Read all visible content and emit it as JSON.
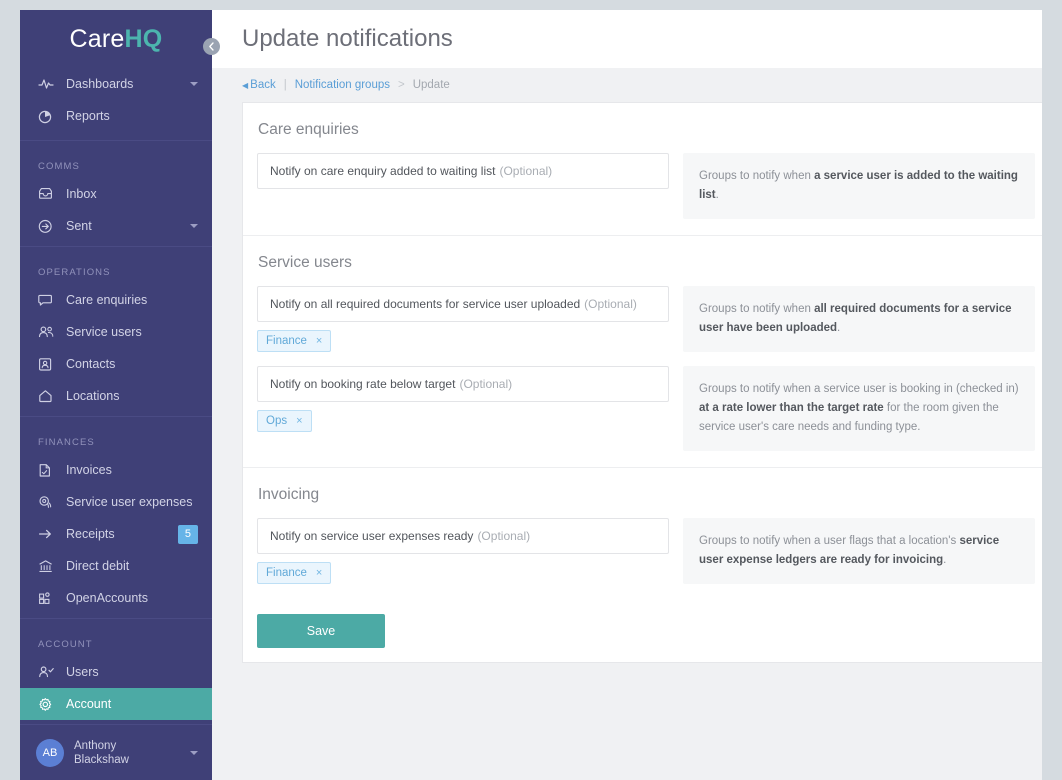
{
  "brand": {
    "part1": "Care",
    "part2": "HQ"
  },
  "sidebar": {
    "collapse_icon": "chevron-left-icon",
    "groups": [
      {
        "label": "",
        "items": [
          {
            "label": "Dashboards",
            "icon": "activity-icon",
            "caret": true,
            "badge": null,
            "active": false
          },
          {
            "label": "Reports",
            "icon": "pie-chart-icon",
            "caret": false,
            "badge": null,
            "active": false
          }
        ]
      },
      {
        "label": "COMMS",
        "items": [
          {
            "label": "Inbox",
            "icon": "inbox-icon",
            "caret": false,
            "badge": null,
            "active": false
          },
          {
            "label": "Sent",
            "icon": "send-circle-icon",
            "caret": true,
            "badge": null,
            "active": false
          }
        ]
      },
      {
        "label": "OPERATIONS",
        "items": [
          {
            "label": "Care enquiries",
            "icon": "speech-bubble-icon",
            "caret": false,
            "badge": null,
            "active": false
          },
          {
            "label": "Service users",
            "icon": "users-icon",
            "caret": false,
            "badge": null,
            "active": false
          },
          {
            "label": "Contacts",
            "icon": "contact-card-icon",
            "caret": false,
            "badge": null,
            "active": false
          },
          {
            "label": "Locations",
            "icon": "home-icon",
            "caret": false,
            "badge": null,
            "active": false
          }
        ]
      },
      {
        "label": "FINANCES",
        "items": [
          {
            "label": "Invoices",
            "icon": "invoice-icon",
            "caret": false,
            "badge": null,
            "active": false
          },
          {
            "label": "Service user expenses",
            "icon": "coins-icon",
            "caret": false,
            "badge": null,
            "active": false
          },
          {
            "label": "Receipts",
            "icon": "arrow-right-icon",
            "caret": false,
            "badge": "5",
            "active": false
          },
          {
            "label": "Direct debit",
            "icon": "bank-icon",
            "caret": false,
            "badge": null,
            "active": false
          },
          {
            "label": "OpenAccounts",
            "icon": "grid-icon",
            "caret": false,
            "badge": null,
            "active": false
          }
        ]
      },
      {
        "label": "ACCOUNT",
        "items": [
          {
            "label": "Users",
            "icon": "user-check-icon",
            "caret": false,
            "badge": null,
            "active": false
          },
          {
            "label": "Account",
            "icon": "gear-icon",
            "caret": false,
            "badge": null,
            "active": true
          }
        ]
      }
    ],
    "user": {
      "initials": "AB",
      "first_name": "Anthony",
      "last_name": "Blackshaw",
      "caret": true
    }
  },
  "header": {
    "title": "Update notifications"
  },
  "breadcrumb": {
    "back": "Back",
    "separator": "|",
    "link": "Notification groups",
    "chevron": ">",
    "current": "Update"
  },
  "sections": [
    {
      "title": "Care enquiries",
      "rows": [
        {
          "field_label": "Notify on care enquiry added to waiting list",
          "optional": "(Optional)",
          "tags": [],
          "desc_prefix": "Groups to notify when ",
          "desc_bold": "a service user is added to the waiting list",
          "desc_suffix": "."
        }
      ]
    },
    {
      "title": "Service users",
      "rows": [
        {
          "field_label": "Notify on all required documents for service user uploaded",
          "optional": "(Optional)",
          "tags": [
            {
              "label": "Finance",
              "remove": "×"
            }
          ],
          "desc_prefix": "Groups to notify when ",
          "desc_bold": "all required documents for a service user have been uploaded",
          "desc_suffix": "."
        },
        {
          "field_label": "Notify on booking rate below target",
          "optional": "(Optional)",
          "tags": [
            {
              "label": "Ops",
              "remove": "×"
            }
          ],
          "desc_prefix": "Groups to notify when a service user is booking in (checked in) ",
          "desc_bold": "at a rate lower than the target rate",
          "desc_suffix": " for the room given the service user's care needs and funding type."
        }
      ]
    },
    {
      "title": "Invoicing",
      "rows": [
        {
          "field_label": "Notify on service user expenses ready",
          "optional": "(Optional)",
          "tags": [
            {
              "label": "Finance",
              "remove": "×"
            }
          ],
          "desc_prefix": "Groups to notify when a user flags that a location's ",
          "desc_bold": "service user expense ledgers are ready for invoicing",
          "desc_suffix": "."
        }
      ]
    }
  ],
  "actions": {
    "save_label": "Save"
  },
  "colors": {
    "sidebar_bg": "#3f4077",
    "accent_teal": "#4caaa5",
    "badge_blue": "#66b4e8",
    "tag_blue": "#61a9d8",
    "page_bg": "#f0f1f3",
    "link_blue": "#5a9ed6"
  }
}
